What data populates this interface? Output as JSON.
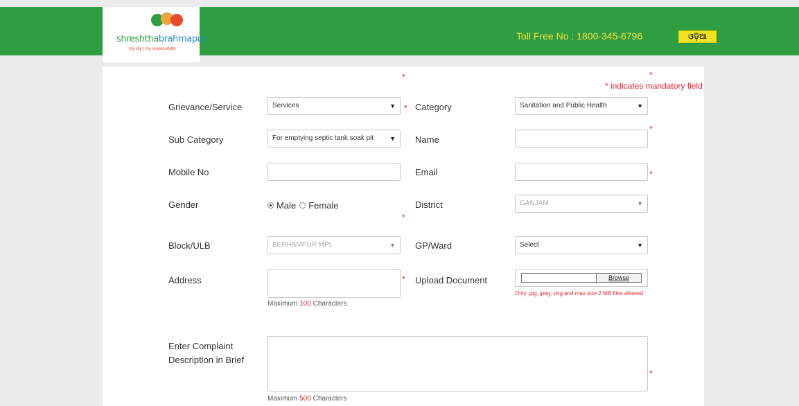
{
  "header": {
    "logo": {
      "name_part1": "shreshtha",
      "name_part2": "brahmapur",
      "tagline": "my city | my responsibility"
    },
    "toll_free": "Toll Free No : 1800-345-6796",
    "language_button": "ଓଡ଼ିଆ"
  },
  "form": {
    "mandatory_note": "* indicates mandatory field",
    "grievance_service": {
      "label": "Grievance/Service",
      "value": "Services"
    },
    "category": {
      "label": "Category",
      "value": "Sanitation and Public Health"
    },
    "sub_category": {
      "label": "Sub Category",
      "value": "For emptying septic tank soak pit"
    },
    "name": {
      "label": "Name",
      "value": ""
    },
    "mobile": {
      "label": "Mobile No",
      "value": ""
    },
    "email": {
      "label": "Email",
      "value": ""
    },
    "gender": {
      "label": "Gender",
      "options": [
        "Male",
        "Female"
      ],
      "selected": "Male"
    },
    "district": {
      "label": "District",
      "value": "GANJAM"
    },
    "block_ulb": {
      "label": "Block/ULB",
      "value": "BERHAMPUR MPL"
    },
    "gp_ward": {
      "label": "GP/Ward",
      "value": "Select"
    },
    "address": {
      "label": "Address",
      "hint_prefix": "Maximum",
      "max": "100",
      "hint_suffix": "Characters"
    },
    "upload": {
      "label": "Upload Document",
      "button": "Browse",
      "note": "Only .jpg, jpeg, png and max size 2 MB files allowed."
    },
    "description": {
      "label_line1": "Enter Complaint",
      "label_line2": "Description in Brief",
      "hint_prefix": "Maximum",
      "max": "500",
      "hint_suffix": "Characters"
    },
    "required_mark": "*"
  },
  "colors": {
    "header_green": "#2f9e43",
    "toll_yellow": "#f3e23a",
    "required_red": "#e4232c"
  }
}
